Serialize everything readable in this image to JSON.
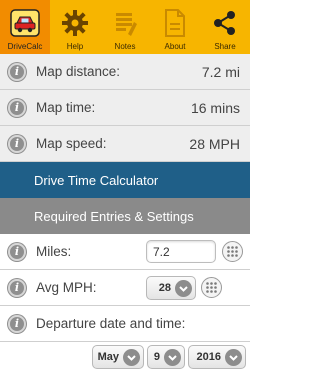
{
  "toolbar": {
    "items": [
      {
        "label": "DriveCalc",
        "icon": "car-icon"
      },
      {
        "label": "Help",
        "icon": "gear-icon"
      },
      {
        "label": "Notes",
        "icon": "notes-icon"
      },
      {
        "label": "About",
        "icon": "document-icon"
      },
      {
        "label": "Share",
        "icon": "share-icon"
      }
    ]
  },
  "results": {
    "map_distance": {
      "label": "Map distance:",
      "value": "7.2 mi"
    },
    "map_time": {
      "label": "Map time:",
      "value": "16 mins"
    },
    "map_speed": {
      "label": "Map speed:",
      "value": "28 MPH"
    }
  },
  "sections": {
    "calculator": "Drive Time Calculator",
    "settings": "Required Entries & Settings"
  },
  "form": {
    "miles": {
      "label": "Miles:",
      "value": "7.2"
    },
    "avg_mph": {
      "label": "Avg MPH:",
      "value": "28"
    },
    "departure": {
      "label": "Departure date and time:"
    },
    "date": {
      "month": "May",
      "day": "9",
      "year": "2016"
    }
  },
  "colors": {
    "toolbar": "#f7b500",
    "toolbar_active": "#f28c00",
    "section_blue": "#1f5f88",
    "section_grey": "#8a8a8a"
  }
}
